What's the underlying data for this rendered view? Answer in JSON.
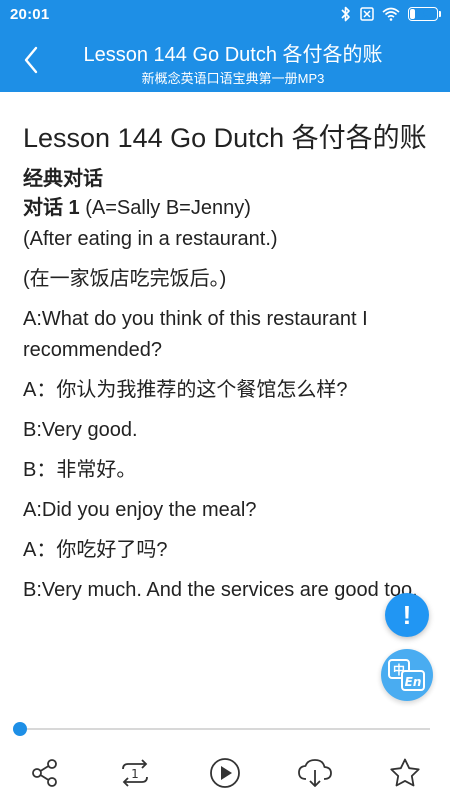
{
  "status_bar": {
    "time": "20:01",
    "battery_level": "19",
    "battery_fraction": 0.19,
    "icons": [
      "bluetooth-icon",
      "sim-off-icon",
      "wifi-icon",
      "battery-icon"
    ]
  },
  "header": {
    "title": "Lesson 144 Go Dutch 各付各的账",
    "subtitle": "新概念英语口语宝典第一册MP3",
    "back_icon": "chevron-left-icon",
    "color": "#1E8FE6"
  },
  "content": {
    "lesson_title": "Lesson 144 Go Dutch 各付各的账",
    "section_title": "经典对话",
    "dialog_label": "对话 1",
    "dialog_participants": " (A=Sally B=Jenny)",
    "scene_en": "(After eating in a restaurant.)",
    "scene_zh": "(在一家饭店吃完饭后。)",
    "lines": [
      "A:What do you think of this restaurant I recommended?",
      "A：你认为我推荐的这个餐馆怎么样?",
      "B:Very good.",
      "B：非常好。",
      "A:Did you enjoy the meal?",
      "A：你吃好了吗?",
      "B:Very much. And the services are good too."
    ]
  },
  "floating": {
    "alert_symbol": "!",
    "alert_icon": "exclamation-icon",
    "translate_icon": "zh-en-translate-icon",
    "translate_zh": "中",
    "translate_en": "En"
  },
  "player": {
    "progress": 0,
    "accent": "#1E8FE6"
  },
  "toolbar": {
    "items": [
      "share-icon",
      "repeat-one-icon",
      "play-icon",
      "download-cloud-icon",
      "star-icon"
    ],
    "repeat_count": "1"
  }
}
